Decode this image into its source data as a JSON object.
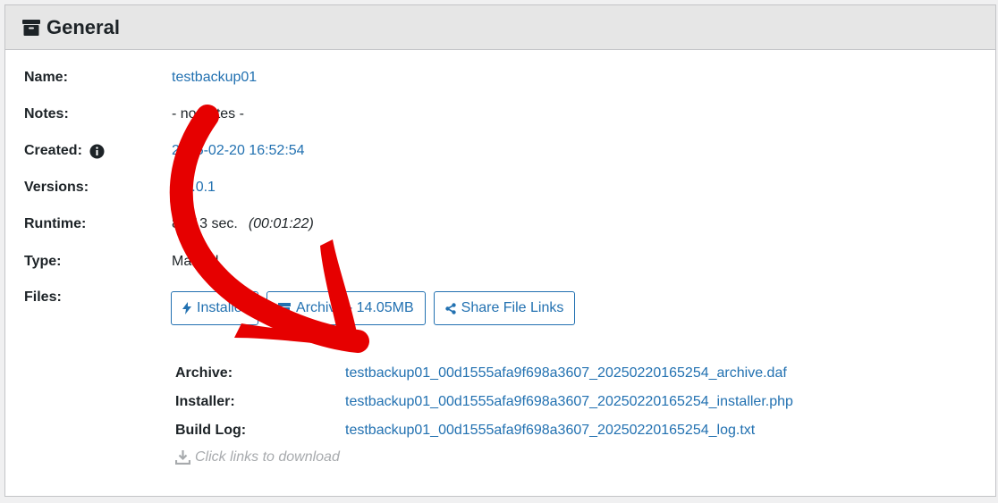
{
  "panel": {
    "title": "General",
    "icon": "archive-box-icon"
  },
  "details": {
    "name": {
      "label": "Name:",
      "value": "testbackup01"
    },
    "notes": {
      "label": "Notes:",
      "value": "- no notes -"
    },
    "created": {
      "label": "Created:",
      "value": "2025-02-20 16:52:54"
    },
    "versions": {
      "label": "Versions:",
      "value": "4.5.0.1"
    },
    "runtime": {
      "label": "Runtime:",
      "value": "82.13 sec.",
      "formatted": "(00:01:22)"
    },
    "type": {
      "label": "Type:",
      "value": "Manual"
    },
    "files_label": "Files:"
  },
  "buttons": {
    "installer": "Installer",
    "archive": "Archive - 14.05MB",
    "share": "Share File Links"
  },
  "files": [
    {
      "label": "Archive:",
      "link": "testbackup01_00d1555afa9f698a3607_20250220165254_archive.daf"
    },
    {
      "label": "Installer:",
      "link": "testbackup01_00d1555afa9f698a3607_20250220165254_installer.php"
    },
    {
      "label": "Build Log:",
      "link": "testbackup01_00d1555afa9f698a3607_20250220165254_log.txt"
    }
  ],
  "download_hint": "Click links to download",
  "colors": {
    "link": "#2271b1",
    "arrow": "#e60000",
    "header_bg": "#e6e6e6"
  }
}
